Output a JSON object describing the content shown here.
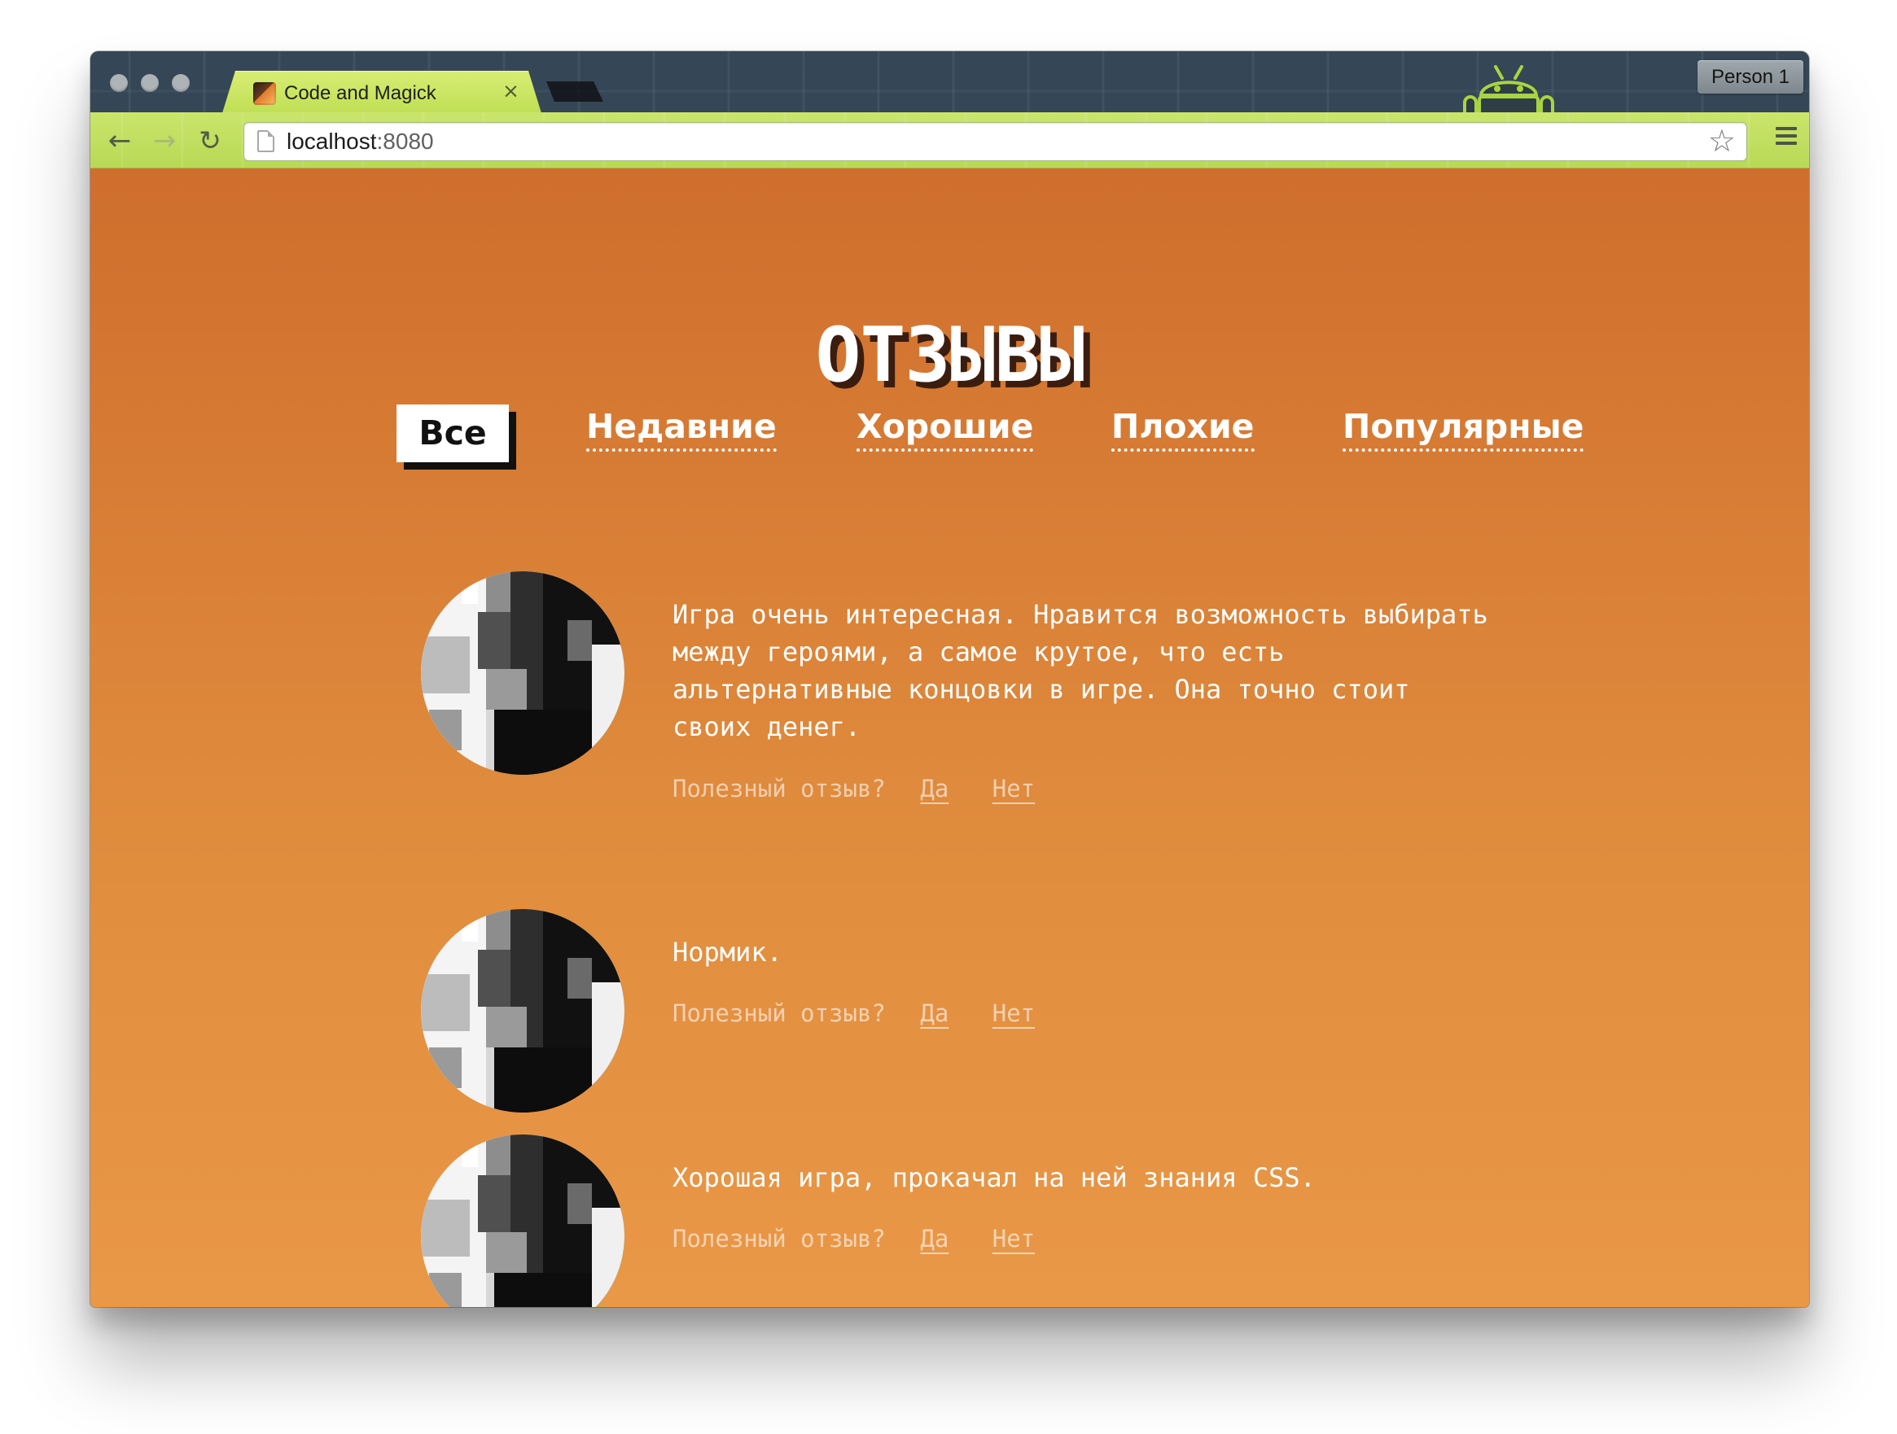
{
  "browser": {
    "tab_title": "Code and Magick",
    "close_symbol": "×",
    "profile_label": "Person 1",
    "url_host": "localhost",
    "url_port": ":8080",
    "back_symbol": "←",
    "forward_symbol": "→",
    "reload_symbol": "↻",
    "bookmark_symbol": "☆",
    "icons": {
      "favicon": "code-and-magick-favicon",
      "page": "page-icon",
      "menu": "hamburger-menu-icon",
      "profile_art": "android-mascot-icon"
    },
    "colors": {
      "chrome_dark": "#3a4c5b",
      "chrome_green": "#c0df55"
    }
  },
  "page": {
    "title": "ОТЗЫВЫ",
    "colors": {
      "background_top": "#cf6e2d",
      "background_bottom": "#e99847",
      "title_shadow": "#3b1d10"
    },
    "filters": [
      {
        "label": "Все",
        "active": true
      },
      {
        "label": "Недавние",
        "active": false
      },
      {
        "label": "Хорошие",
        "active": false
      },
      {
        "label": "Плохие",
        "active": false
      },
      {
        "label": "Популярные",
        "active": false
      }
    ],
    "reviews": [
      {
        "text": "Игра очень интересная. Нравится возможность выбирать между героями, а самое крутое, что есть альтернативные концовки в игре. Она точно стоит своих денег.",
        "prompt": "Полезный отзыв?",
        "yes": "Да",
        "no": "Нет",
        "avatar": "pixelated-photo-avatar"
      },
      {
        "text": "Нормик.",
        "prompt": "Полезный отзыв?",
        "yes": "Да",
        "no": "Нет",
        "avatar": "pixelated-photo-avatar"
      },
      {
        "text": "Хорошая игра, прокачал на ней знания CSS.",
        "prompt": "Полезный отзыв?",
        "yes": "Да",
        "no": "Нет",
        "avatar": "pixelated-photo-avatar"
      }
    ]
  }
}
